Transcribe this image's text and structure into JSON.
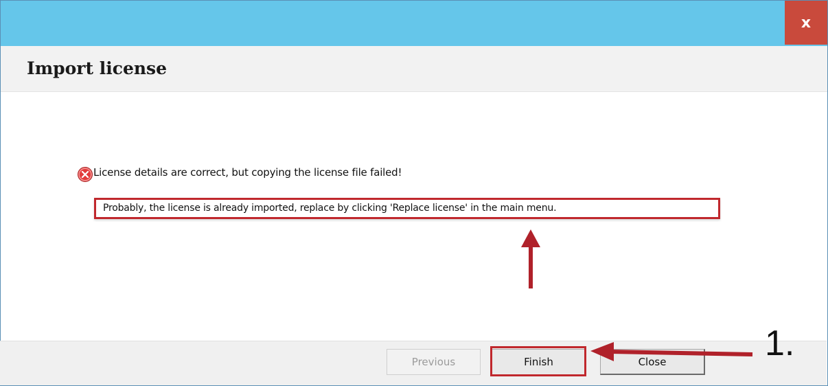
{
  "window": {
    "close_glyph": "x"
  },
  "header": {
    "title": "Import license"
  },
  "content": {
    "error_icon": "error-circle-icon",
    "error_message": "License details are correct, but copying the license file failed!",
    "detail_message": "Probably, the license is already imported, replace by clicking 'Replace license' in the main menu."
  },
  "footer": {
    "previous_label": "Previous",
    "finish_label": "Finish",
    "close_label": "Close"
  },
  "annotations": {
    "step_label": "1.",
    "highlight_color": "#c0282d"
  },
  "colors": {
    "titlebar": "#65c6ea",
    "close_button": "#c94a3c"
  }
}
